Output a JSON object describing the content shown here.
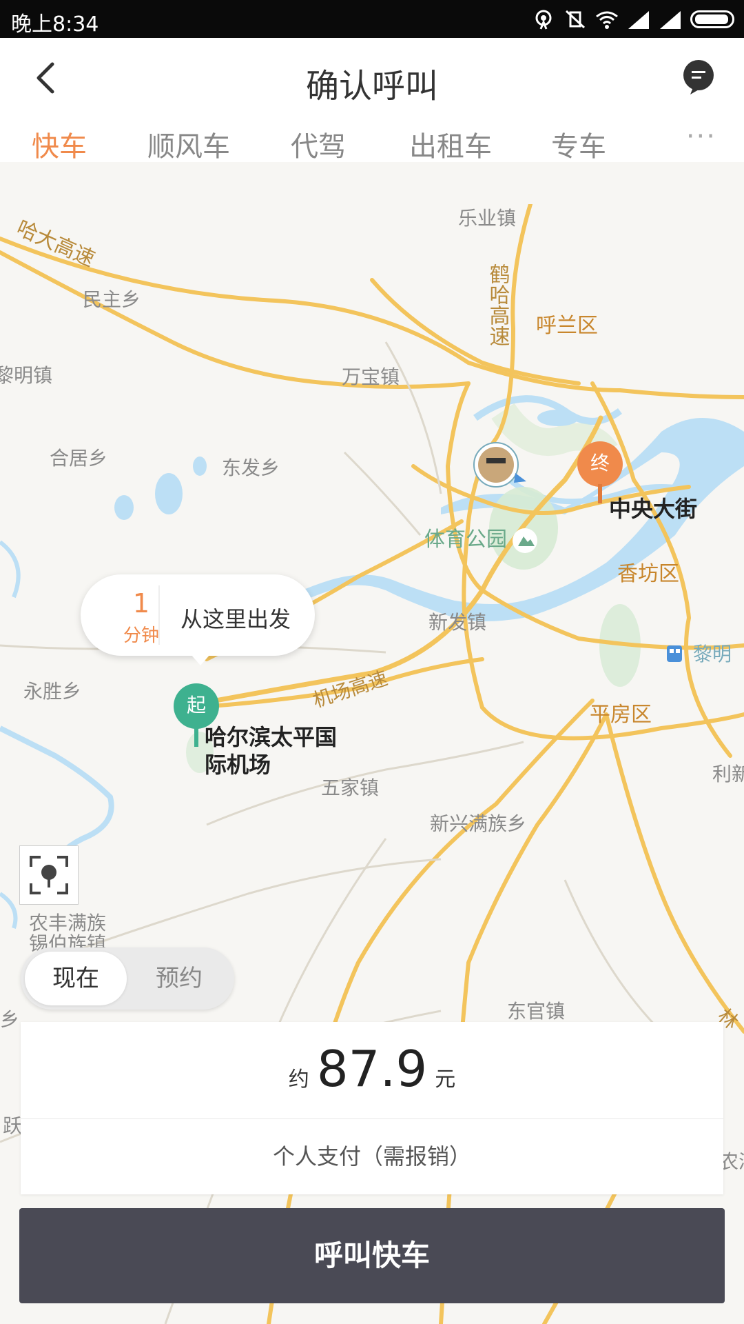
{
  "status_bar": {
    "time": "晚上8:34"
  },
  "header": {
    "title": "确认呼叫",
    "tabs": [
      {
        "label": "快车",
        "active": true
      },
      {
        "label": "顺风车"
      },
      {
        "label": "代驾"
      },
      {
        "label": "出租车"
      },
      {
        "label": "专车"
      }
    ],
    "more": "···"
  },
  "map": {
    "labels": {
      "l1": "乐业镇",
      "l2": "哈大高速",
      "l3": "民主乡",
      "l4": "鹤哈高速",
      "l5": "呼兰区",
      "l6": "黎明镇",
      "l7": "万宝镇",
      "l8": "合居乡",
      "l9": "东发乡",
      "l10": "体育公园",
      "l11": "香坊区",
      "l12": "机场高速",
      "l13": "新发镇",
      "l14": "黎明",
      "l15": "永胜乡",
      "l16": "平房区",
      "l17": "五家镇",
      "l18": "新兴满族乡",
      "l19": "利新",
      "l20": "农丰满族",
      "l21": "锡伯族镇",
      "l22": "东官镇",
      "l23": "乡",
      "l24": "跃",
      "l25": "农满",
      "l26": "林"
    },
    "start": {
      "badge": "起",
      "name_line1": "哈尔滨太平国",
      "name_line2": "际机场"
    },
    "end": {
      "badge": "终",
      "name": "中央大街"
    },
    "eta_bubble": {
      "value": "1",
      "unit": "分钟",
      "text": "从这里出发"
    }
  },
  "time_toggle": {
    "now": "现在",
    "reserve": "预约"
  },
  "fare": {
    "prefix": "约",
    "value": "87.9",
    "unit": "元",
    "payment": "个人支付（需报销）"
  },
  "call_button": "呼叫快车",
  "colors": {
    "accent": "#f08a4b",
    "start_pin": "#3eb18f",
    "end_pin": "#f08a4b",
    "button_bg": "#4a4a55",
    "road": "#f3c45c",
    "water": "#bcdff5"
  }
}
